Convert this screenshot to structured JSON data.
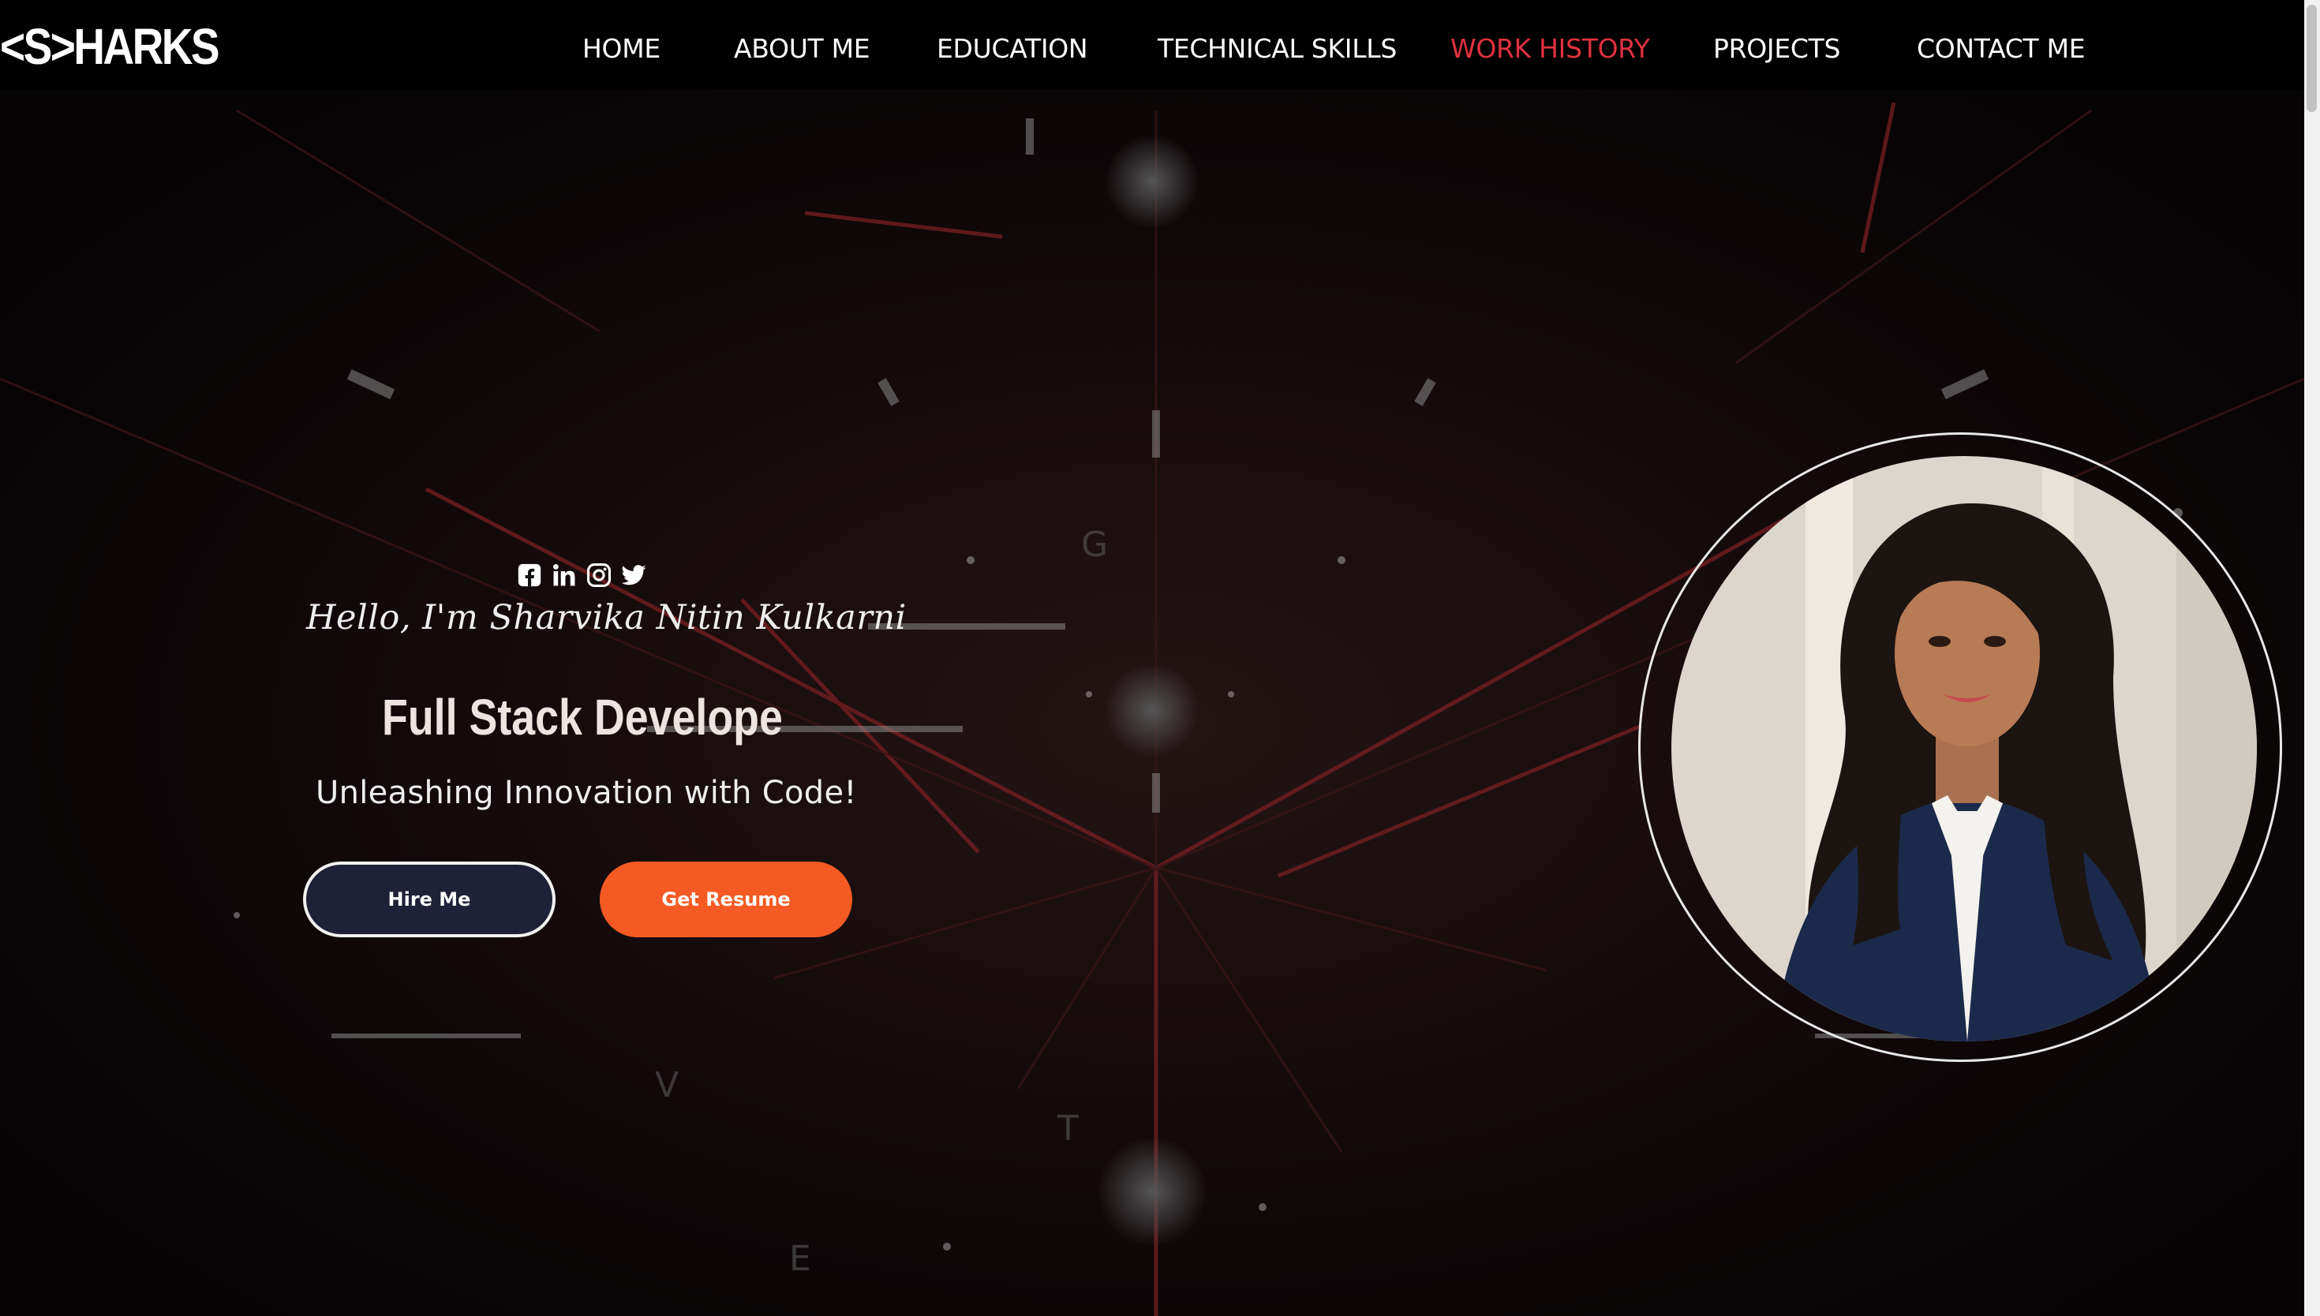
{
  "site": {
    "logo": "<S>HARKS"
  },
  "nav": {
    "items": [
      {
        "label": "HOME"
      },
      {
        "label": "ABOUT ME"
      },
      {
        "label": "EDUCATION"
      },
      {
        "label": "TECHNICAL SKILLS"
      },
      {
        "label": "WORK HISTORY"
      },
      {
        "label": "PROJECTS"
      },
      {
        "label": "CONTACT ME"
      }
    ],
    "active": "WORK HISTORY"
  },
  "hero": {
    "social_icons": [
      "facebook-icon",
      "linkedin-icon",
      "instagram-icon",
      "twitter-icon"
    ],
    "greeting": "Hello, I'm Sharvika Nitin Kulkarni",
    "role": "Full Stack Develope",
    "tagline": "Unleashing Innovation with Code!",
    "buttons": {
      "hire": "Hire Me",
      "resume": "Get Resume"
    }
  },
  "colors": {
    "active_nav": "#e0313f",
    "accent": "#f65a24",
    "hire_button": "#1f2138",
    "background": "#050304"
  }
}
